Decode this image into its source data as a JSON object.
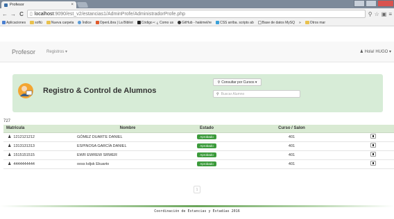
{
  "browser": {
    "tab_title": "Profesor",
    "tab_close": "×",
    "url_host": "localhost",
    "url_path": ":9090/est_v2/estancias1/AdminProfe/AdministradorProfe.php",
    "back": "←",
    "forward": "→",
    "reload": "C",
    "bookmarks": [
      {
        "label": "Aplicaciones",
        "icon": "apps-icon"
      },
      {
        "label": "softü",
        "icon": "folder-icon"
      },
      {
        "label": "Nueva carpeta",
        "icon": "folder-icon"
      },
      {
        "label": "Índice",
        "icon": "globe-icon"
      },
      {
        "label": "OpenLibra | La Bibliot",
        "icon": "book-icon"
      },
      {
        "label": "Código •: ¿ Como us",
        "icon": "code-icon"
      },
      {
        "label": "GitHub - hakimel/re",
        "icon": "github-icon"
      },
      {
        "label": "CSS arriba. scripts ab",
        "icon": "css-icon"
      },
      {
        "label": "Base de datos MySQ",
        "icon": "page-icon"
      },
      {
        "label": "»",
        "icon": ""
      },
      {
        "label": "Otros mar",
        "icon": "folder-icon"
      }
    ]
  },
  "navbar": {
    "brand": "Profesor",
    "menu": "Registros ▾",
    "user": "Hola! HUGO ▾"
  },
  "header": {
    "title": "Registro & Control de Alumnos",
    "consult_button": "Consultar por Cursos ▾",
    "search_placeholder": "Buscar Alumno"
  },
  "count": "727",
  "table": {
    "columns": [
      "Matricula",
      "Nombre",
      "Estado",
      "Curso / Salon",
      ""
    ],
    "rows": [
      {
        "matricula": "1212121212",
        "nombre": "GÓMEZ DUARTE DANIEL",
        "estado": "Aprobado",
        "curso": "401"
      },
      {
        "matricula": "1313131313",
        "nombre": "ESPINOSA GARCÍA DANIEL",
        "estado": "Aprobado",
        "curso": "401"
      },
      {
        "matricula": "1515151515",
        "nombre": "EWR EWREW SRWER",
        "estado": "Aprobado",
        "curso": "401"
      },
      {
        "matricula": "4444444444",
        "nombre": "ooss kdjsk Ekuarto",
        "estado": "Aprobado",
        "curso": "401"
      }
    ]
  },
  "pager": "1",
  "footer": "Coordinación de Estancias y Estadías 2016",
  "colors": {
    "accent_green": "#3c9b3c",
    "header_bg": "#d7ecd7"
  }
}
